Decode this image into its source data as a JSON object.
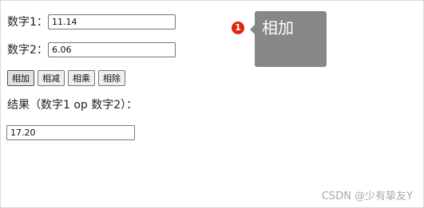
{
  "form": {
    "num1_label": "数字1：",
    "num1_value": "11.14",
    "num2_label": "数字2：",
    "num2_value": "6.06"
  },
  "buttons": {
    "add": "相加",
    "subtract": "相减",
    "multiply": "相乘",
    "divide": "相除"
  },
  "result": {
    "label": "结果（数字1 op 数字2）：",
    "value": "17.20"
  },
  "annotation": {
    "step_number": "1",
    "tooltip_text": "相加",
    "badge_color": "#e0240f",
    "tooltip_color": "#878787"
  },
  "watermark": "CSDN @少有挚友Y"
}
